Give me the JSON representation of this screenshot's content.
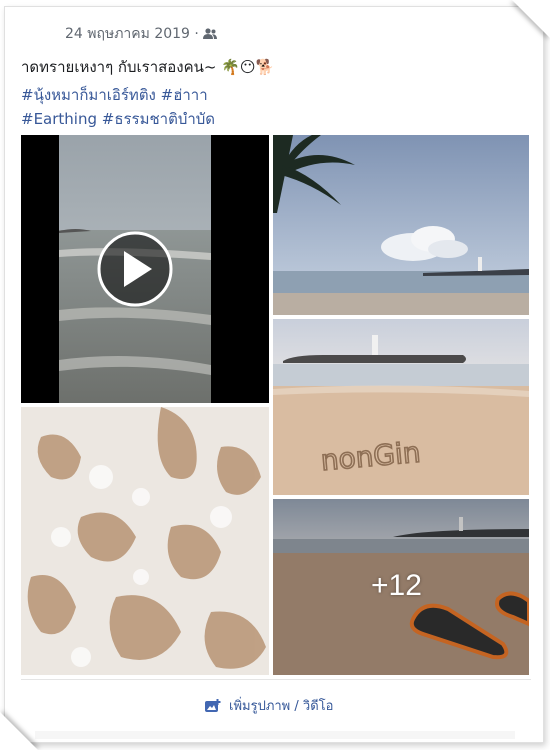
{
  "post": {
    "date": "24 พฤษภาคม 2019 ·",
    "audience_icon": "friends-icon",
    "text": "าดทรายเหงาๆ กับเราสองคน~ 🌴😶🐕",
    "hashtags_line1": "#นุ้งหมาก็มาเอิร์ทติง #ฮ่าาา",
    "hashtags_line2": "#Earthing #ธรรมชาติบำบัด"
  },
  "media": {
    "video_play_icon": "play-icon",
    "more_count": "+12",
    "sand_text": "nonGin"
  },
  "footer": {
    "add_label": "เพิ่มรูปภาพ / วิดีโอ",
    "add_icon": "add-photo-icon"
  },
  "colors": {
    "link": "#385898",
    "text": "#1c1e21",
    "meta": "#606770"
  }
}
